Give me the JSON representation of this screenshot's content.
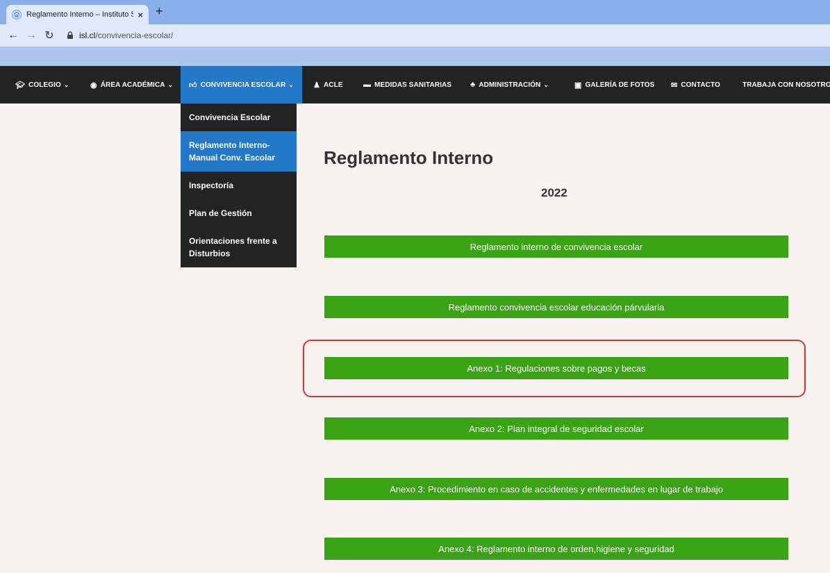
{
  "browser": {
    "tab_title": "Reglamento Interno – Instituto S",
    "new_tab": "+",
    "close": "×",
    "url_host": "isl.cl",
    "url_path": "/convivencia-escolar/"
  },
  "nav": {
    "items": [
      {
        "label": "COLEGIO",
        "icon": "graduation-cap-icon"
      },
      {
        "label": "ÁREA ACADÉMICA",
        "icon": "compass-icon"
      },
      {
        "label": "CONVIVENCIA ESCOLAR",
        "icon": "thumbs-up-icon"
      },
      {
        "label": "ACLE",
        "icon": "running-person-icon"
      },
      {
        "label": "MEDIDAS SANITARIAS",
        "icon": "folder-icon"
      },
      {
        "label": "ADMINISTRACIÓN",
        "icon": "sitemap-icon"
      },
      {
        "label": "GALERÍA DE FOTOS",
        "icon": "image-icon"
      },
      {
        "label": "CONTACTO",
        "icon": "envelope-icon"
      },
      {
        "label": "TRABAJA CON NOSOTROS",
        "icon": ""
      }
    ]
  },
  "dropdown": {
    "items": [
      "Convivencia Escolar",
      "Reglamento Interno-Manual Conv. Escolar",
      "Inspectoría",
      "Plan de Gestión",
      "Orientaciones frente a Disturbios"
    ]
  },
  "content": {
    "title": "Reglamento Interno",
    "year": "2022",
    "buttons": [
      "Reglamento interno de convivencia escolar",
      "Reglamento convivencia escolar educación párvularia",
      "Anexo 1: Regulaciones sobre pagos y becas",
      "Anexo 2: Plan integral de seguridad escolar",
      "Anexo 3: Procedimiento en caso de accidentes y enfermedades en lugar de trabajo",
      "Anexo 4: Reglamento interno de orden,higiene y seguridad"
    ]
  },
  "colors": {
    "button_green": "#3aa315",
    "nav_dark": "#232323",
    "active_blue": "#2378c8",
    "highlight_red": "#d93333"
  }
}
